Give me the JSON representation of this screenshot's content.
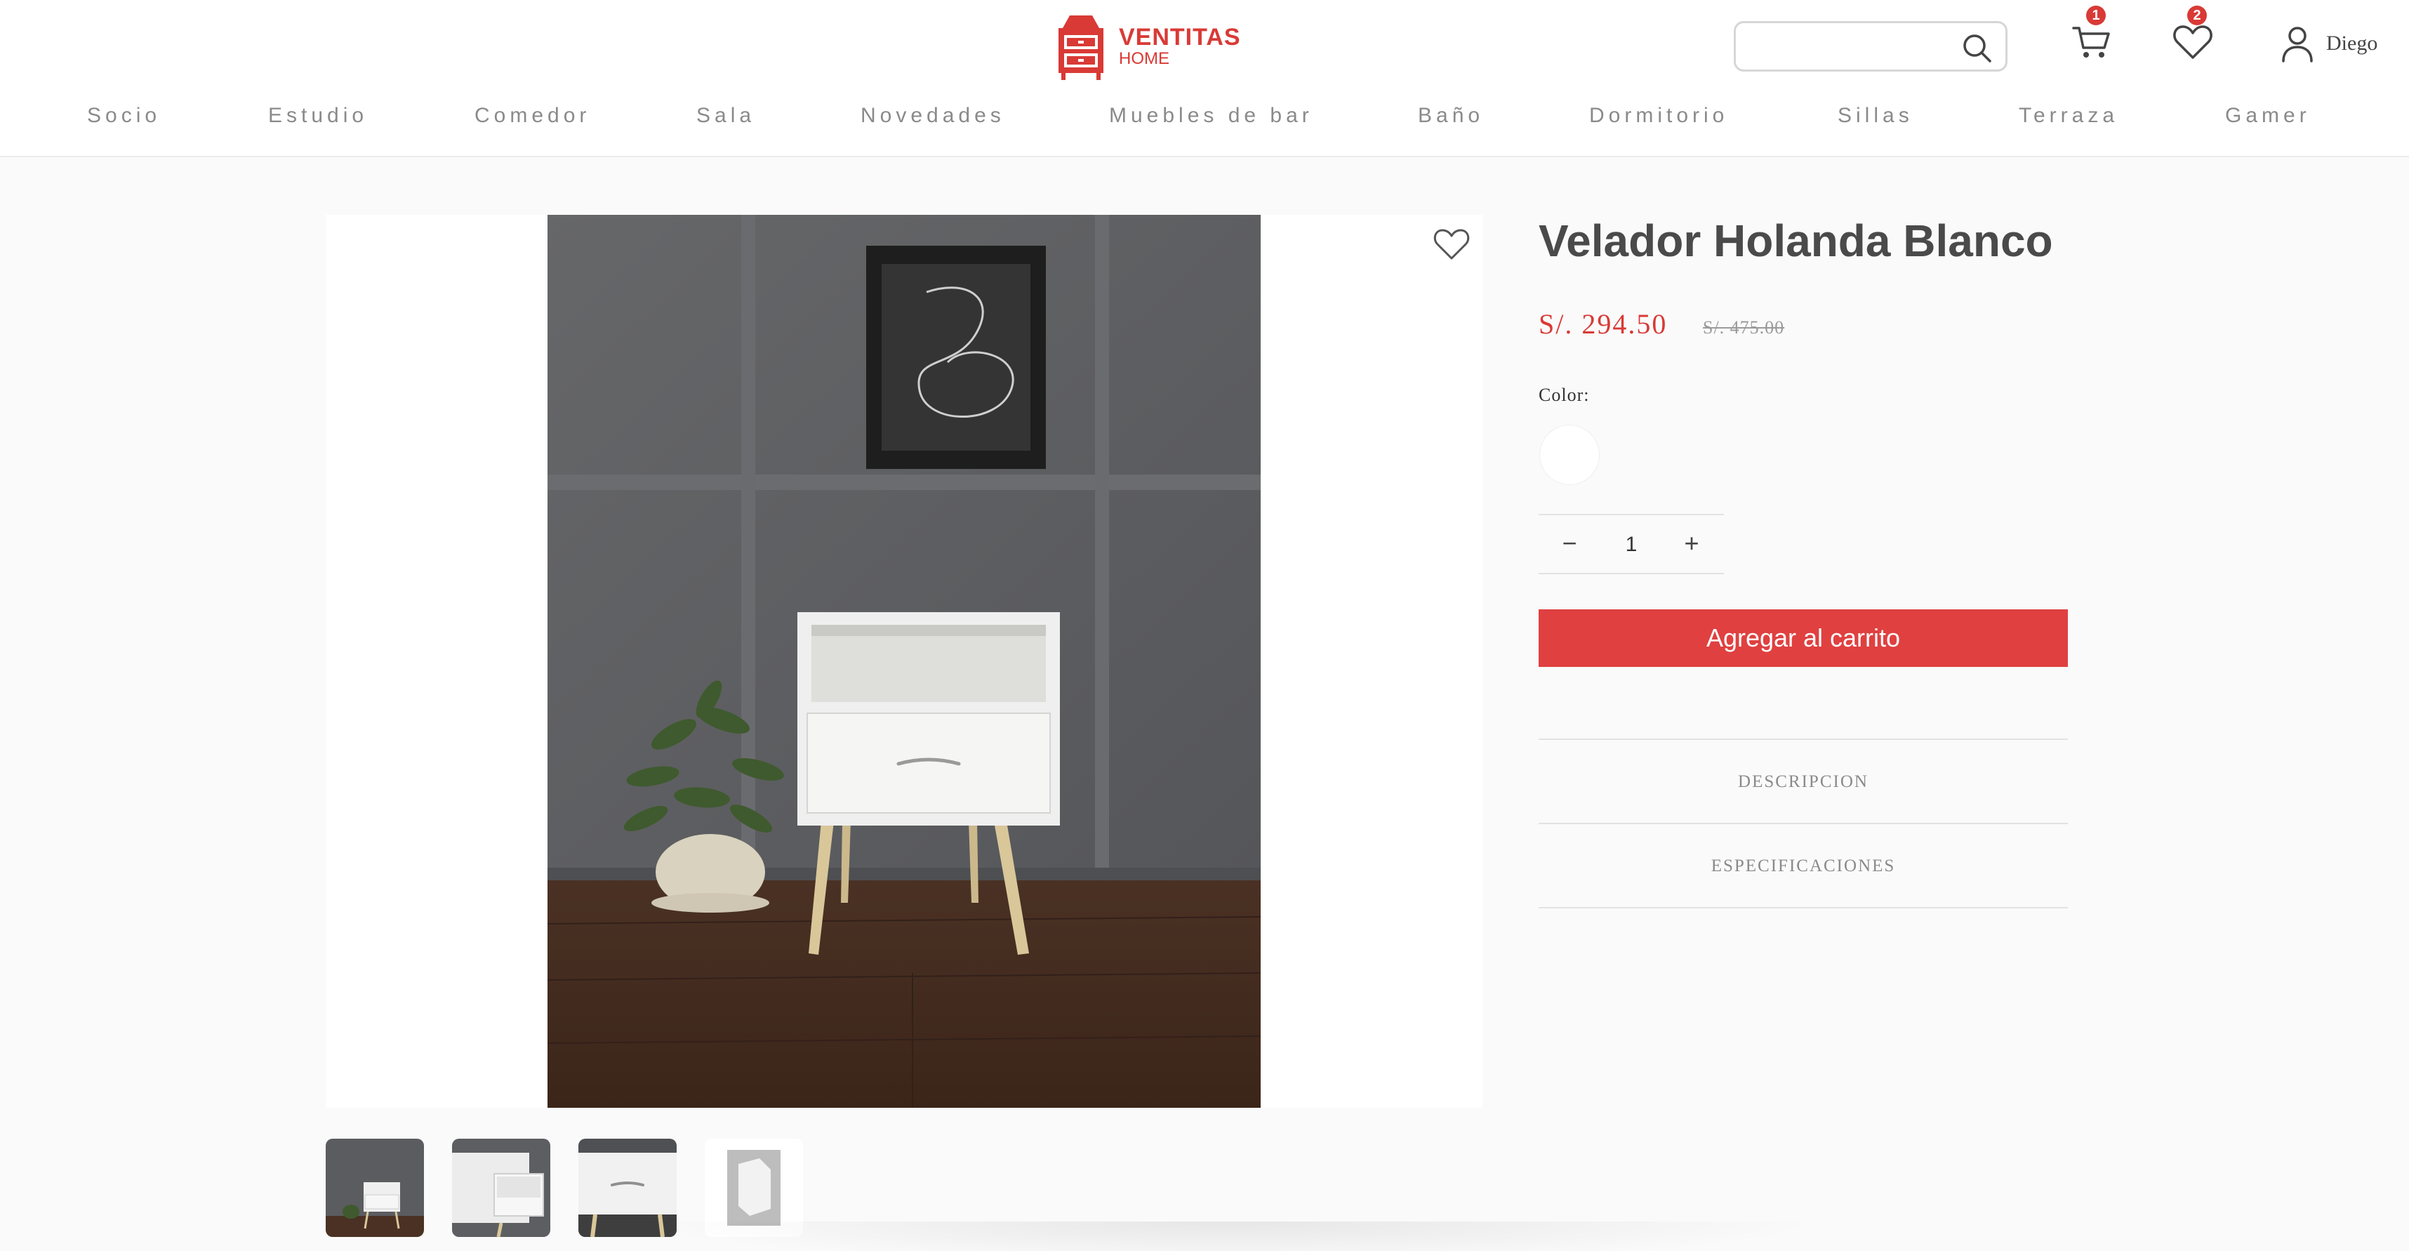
{
  "header": {
    "logo": {
      "brand": "VENTITAS",
      "sub": "HOME",
      "color": "#d93a36"
    },
    "search": {
      "placeholder": "",
      "icon": "search-icon"
    },
    "cart": {
      "icon": "cart-icon",
      "count": "1"
    },
    "wishlist": {
      "icon": "heart-icon",
      "count": "2"
    },
    "user": {
      "icon": "user-icon",
      "name": "Diego"
    }
  },
  "nav": {
    "items": [
      "Socio",
      "Estudio",
      "Comedor",
      "Sala",
      "Novedades",
      "Muebles de bar",
      "Baño",
      "Dormitorio",
      "Sillas",
      "Terraza",
      "Gamer"
    ]
  },
  "product": {
    "title": "Velador Holanda Blanco",
    "price": "S/. 294.50",
    "old_price": "S/. 475.00",
    "color_label": "Color:",
    "colors": [
      {
        "name": "Blanco",
        "hex": "#ffffff"
      }
    ],
    "quantity": {
      "minus": "−",
      "value": "1",
      "plus": "+"
    },
    "add_to_cart": "Agregar al carrito",
    "accordion": [
      "DESCRIPCION",
      "ESPECIFICACIONES"
    ],
    "thumbnails": [
      "front-view",
      "drawer-detail",
      "handle-detail",
      "packaging"
    ]
  },
  "theme": {
    "accent": "#e04040",
    "price_color": "#d93a36",
    "nav_color": "#8a8a8a"
  }
}
